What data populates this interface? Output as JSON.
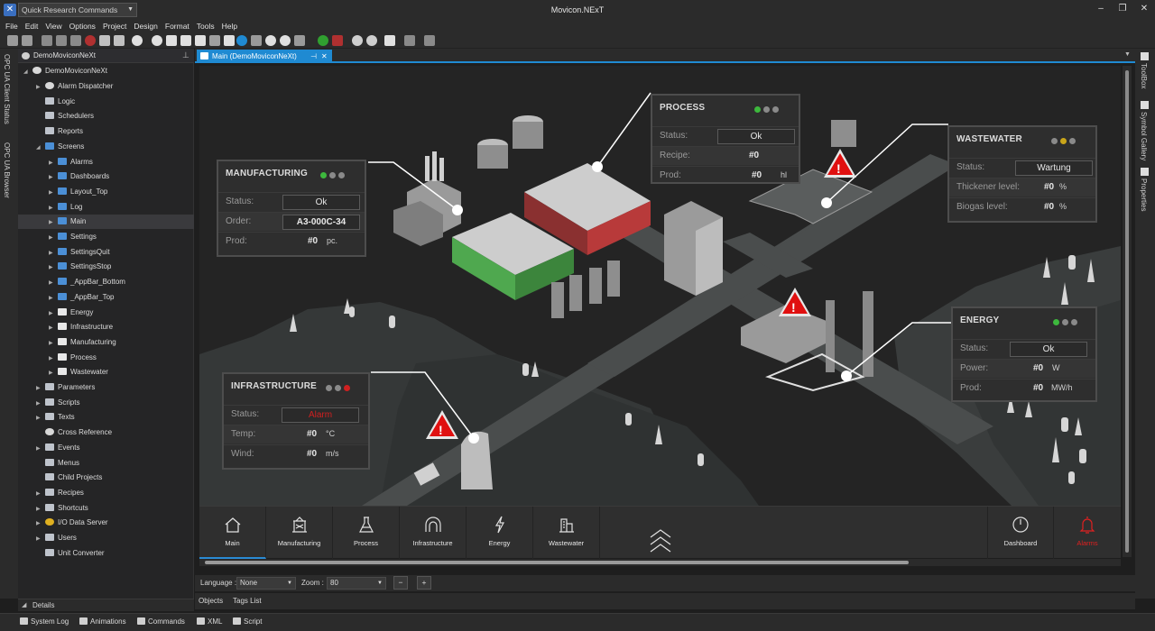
{
  "titlebar": {
    "quick_commands": "Quick Research Commands",
    "app_title": "Movicon.NExT"
  },
  "menu": [
    "File",
    "Edit",
    "View",
    "Options",
    "Project",
    "Design",
    "Format",
    "Tools",
    "Help"
  ],
  "left_vtabs": [
    "OPC UA Client Status",
    "OPC UA Browser"
  ],
  "right_vtabs": [
    "ToolBox",
    "Symbol Gallery",
    "Properties"
  ],
  "tree": {
    "header": "DemoMoviconNeXt",
    "root": "DemoMoviconNeXt",
    "items": [
      {
        "label": "Alarm Dispatcher",
        "level": 1,
        "icon": "gear",
        "arrow": true
      },
      {
        "label": "Logic",
        "level": 1,
        "icon": "doc",
        "arrow": false
      },
      {
        "label": "Schedulers",
        "level": 1,
        "icon": "doc",
        "arrow": false
      },
      {
        "label": "Reports",
        "level": 1,
        "icon": "doc",
        "arrow": false
      },
      {
        "label": "Screens",
        "level": 1,
        "icon": "screen",
        "arrow": true,
        "open": true
      },
      {
        "label": "Alarms",
        "level": 2,
        "icon": "screen",
        "arrow": true
      },
      {
        "label": "Dashboards",
        "level": 2,
        "icon": "screen",
        "arrow": true
      },
      {
        "label": "Layout_Top",
        "level": 2,
        "icon": "screen",
        "arrow": true
      },
      {
        "label": "Log",
        "level": 2,
        "icon": "screen",
        "arrow": true
      },
      {
        "label": "Main",
        "level": 2,
        "icon": "screen",
        "arrow": true,
        "selected": true
      },
      {
        "label": "Settings",
        "level": 2,
        "icon": "screen",
        "arrow": true
      },
      {
        "label": "SettingsQuit",
        "level": 2,
        "icon": "screen",
        "arrow": true
      },
      {
        "label": "SettingsStop",
        "level": 2,
        "icon": "screen",
        "arrow": true
      },
      {
        "label": "_AppBar_Bottom",
        "level": 2,
        "icon": "screen",
        "arrow": true
      },
      {
        "label": "_AppBar_Top",
        "level": 2,
        "icon": "screen",
        "arrow": true
      },
      {
        "label": "Energy",
        "level": 2,
        "icon": "folder",
        "arrow": true
      },
      {
        "label": "Infrastructure",
        "level": 2,
        "icon": "folder",
        "arrow": true
      },
      {
        "label": "Manufacturing",
        "level": 2,
        "icon": "folder",
        "arrow": true
      },
      {
        "label": "Process",
        "level": 2,
        "icon": "folder",
        "arrow": true
      },
      {
        "label": "Wastewater",
        "level": 2,
        "icon": "folder",
        "arrow": true
      },
      {
        "label": "Parameters",
        "level": 1,
        "icon": "doc",
        "arrow": true
      },
      {
        "label": "Scripts",
        "level": 1,
        "icon": "doc",
        "arrow": true
      },
      {
        "label": "Texts",
        "level": 1,
        "icon": "doc",
        "arrow": true
      },
      {
        "label": "Cross Reference",
        "level": 1,
        "icon": "gear",
        "arrow": false
      },
      {
        "label": "Events",
        "level": 1,
        "icon": "doc",
        "arrow": true
      },
      {
        "label": "Menus",
        "level": 1,
        "icon": "doc",
        "arrow": false
      },
      {
        "label": "Child Projects",
        "level": 1,
        "icon": "doc",
        "arrow": false
      },
      {
        "label": "Recipes",
        "level": 1,
        "icon": "doc",
        "arrow": true
      },
      {
        "label": "Shortcuts",
        "level": 1,
        "icon": "doc",
        "arrow": true
      },
      {
        "label": "I/O Data Server",
        "level": 1,
        "icon": "io",
        "arrow": true
      },
      {
        "label": "Users",
        "level": 1,
        "icon": "doc",
        "arrow": true
      },
      {
        "label": "Unit Converter",
        "level": 1,
        "icon": "doc",
        "arrow": false
      }
    ]
  },
  "details_label": "Details",
  "doc_tab": "Main (DemoMoviconNeXt)",
  "panels": {
    "manufacturing": {
      "title": "MANUFACTURING",
      "status_label": "Status:",
      "status": "Ok",
      "order_label": "Order:",
      "order": "A3-000C-34",
      "prod_label": "Prod:",
      "prod": "#0",
      "prod_unit": "pc."
    },
    "process": {
      "title": "PROCESS",
      "status_label": "Status:",
      "status": "Ok",
      "recipe_label": "Recipe:",
      "recipe": "#0",
      "prod_label": "Prod:",
      "prod": "#0",
      "prod_unit": "hl"
    },
    "wastewater": {
      "title": "WASTEWATER",
      "status_label": "Status:",
      "status": "Wartung",
      "thick_label": "Thickener level:",
      "thick": "#0",
      "thick_unit": "%",
      "bio_label": "Biogas level:",
      "bio": "#0",
      "bio_unit": "%"
    },
    "energy": {
      "title": "ENERGY",
      "status_label": "Status:",
      "status": "Ok",
      "power_label": "Power:",
      "power": "#0",
      "power_unit": "W",
      "prod_label": "Prod:",
      "prod": "#0",
      "prod_unit": "MW/h"
    },
    "infrastructure": {
      "title": "INFRASTRUCTURE",
      "status_label": "Status:",
      "status": "Alarm",
      "temp_label": "Temp:",
      "temp": "#0",
      "temp_unit": "°C",
      "wind_label": "Wind:",
      "wind": "#0",
      "wind_unit": "m/s"
    }
  },
  "nav": {
    "main": "Main",
    "manufacturing": "Manufacturing",
    "process": "Process",
    "infrastructure": "Infrastructure",
    "energy": "Energy",
    "wastewater": "Wastewater",
    "dashboard": "Dashboard",
    "alarms": "Alarms"
  },
  "statusbar": {
    "language_label": "Language :",
    "language": "None",
    "zoom_label": "Zoom :",
    "zoom": "80"
  },
  "object_tabs": [
    "Objects",
    "Tags List"
  ],
  "bottom_tabs": [
    "System Log",
    "Animations",
    "Commands",
    "XML",
    "Script"
  ],
  "colors": {
    "accent": "#1f8ad2",
    "ok": "#3db83d",
    "warn": "#c9a51a",
    "alarm": "#d02020",
    "green_building": "#4fa84f",
    "red_building": "#b83a3a"
  }
}
